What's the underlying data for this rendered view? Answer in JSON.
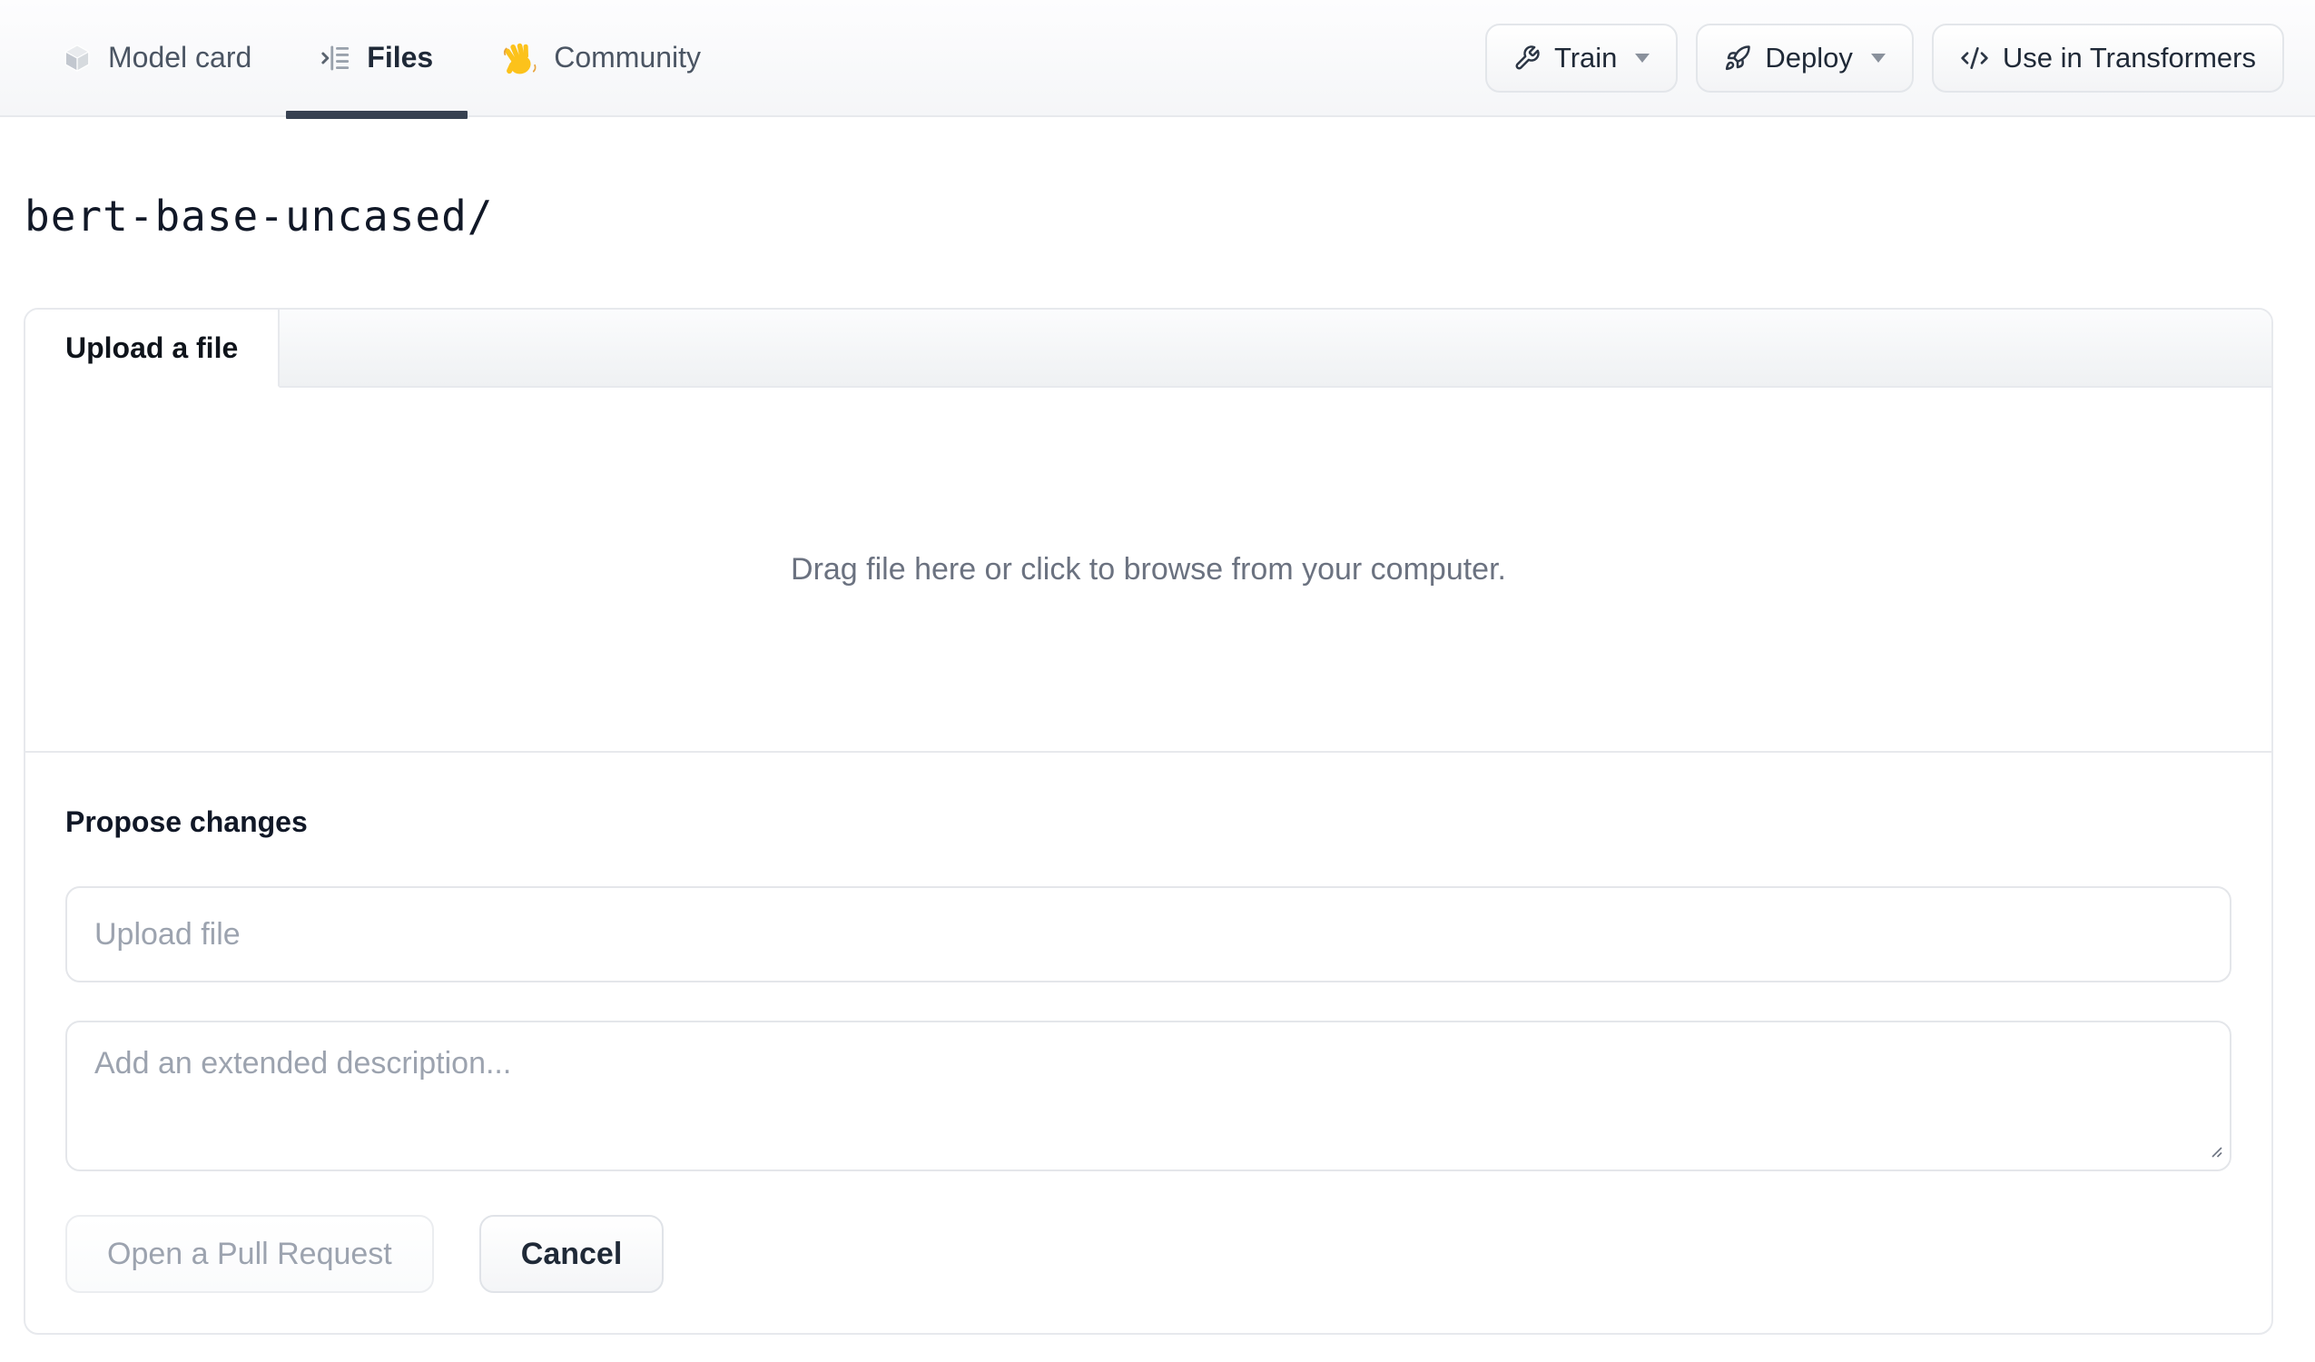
{
  "header": {
    "tabs": [
      {
        "label": "Model card"
      },
      {
        "label": "Files"
      },
      {
        "label": "Community"
      }
    ],
    "actions": {
      "train_label": "Train",
      "deploy_label": "Deploy",
      "use_in_transformers_label": "Use in Transformers"
    }
  },
  "breadcrumb": {
    "path": "bert-base-uncased/"
  },
  "upload_panel": {
    "tab_label": "Upload a file",
    "dropzone_text": "Drag file here or click to browse from your computer.",
    "propose": {
      "heading": "Propose changes",
      "filename_placeholder": "Upload file",
      "description_placeholder": "Add an extended description...",
      "submit_label": "Open a Pull Request",
      "cancel_label": "Cancel"
    }
  },
  "colors": {
    "underline": "#374151",
    "border": "#e7e9ed",
    "text-primary": "#1f2937",
    "text-secondary": "#4b5563",
    "text-muted": "#6b7280",
    "placeholder": "#9ca3af"
  }
}
